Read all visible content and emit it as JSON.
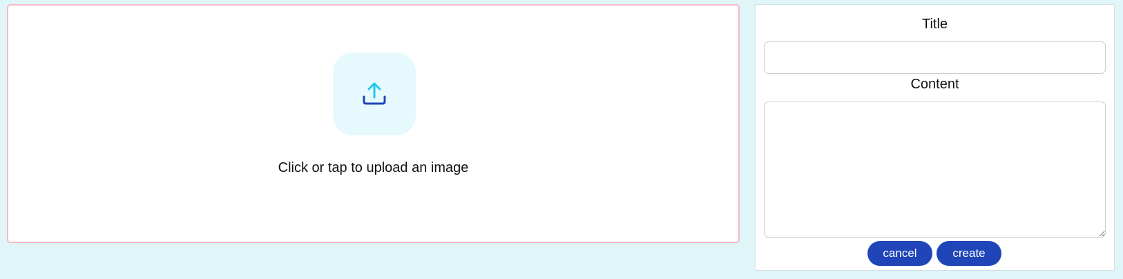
{
  "upload": {
    "prompt": "Click or tap to upload an image",
    "icon": "upload-icon",
    "tile_color": "#e6fafd",
    "arrow_color": "#22c7ee",
    "tray_color": "#1f45b8",
    "border_color": "#f5b8c4"
  },
  "form": {
    "title_label": "Title",
    "title_value": "",
    "content_label": "Content",
    "content_value": "",
    "cancel_label": "cancel",
    "create_label": "create",
    "button_color": "#1f45b8"
  },
  "page": {
    "background_color": "#e0f5f8"
  }
}
